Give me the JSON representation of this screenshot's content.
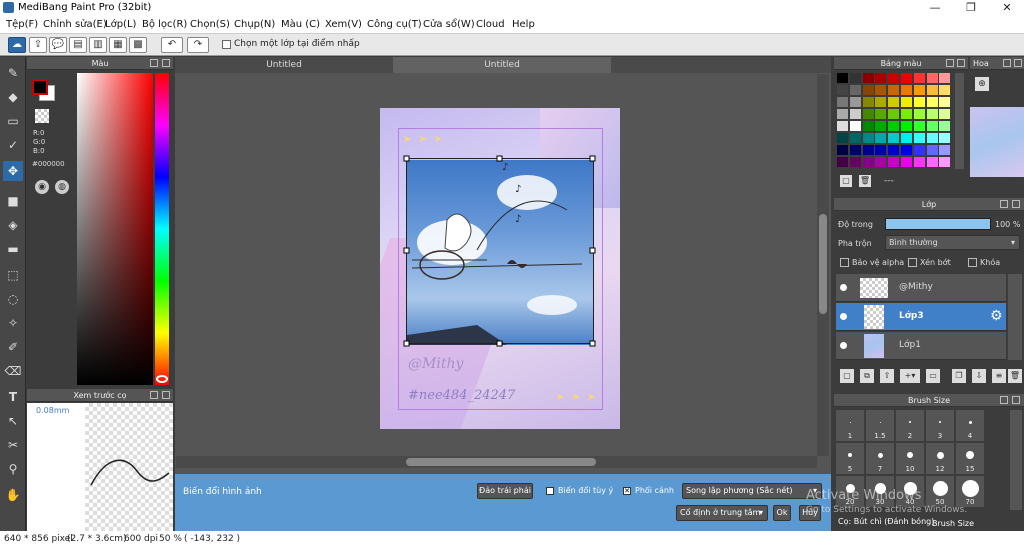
{
  "window": {
    "title": "MediBang Paint Pro (32bit)",
    "minimize": "—",
    "maximize": "❐",
    "close": "✕"
  },
  "menu": [
    "Tệp(F)",
    "Chỉnh sửa(E)",
    "Lớp(L)",
    "Bộ lọc(R)",
    "Chọn(S)",
    "Chụp(N)",
    "Màu (C)",
    "Xem(V)",
    "Công cụ(T)",
    "Cửa sổ(W)",
    "Cloud",
    "Help"
  ],
  "toolbar": {
    "checkbox_label": "Chọn một lớp tại điểm nhấp"
  },
  "color_panel": {
    "title": "Màu",
    "r": "R:0",
    "g": "G:0",
    "b": "B:0",
    "hex": "#000000"
  },
  "preview_panel": {
    "title": "Xem trước cọ",
    "size": "0.08mm"
  },
  "tabs": [
    "Untitled",
    "Untitled"
  ],
  "canvas": {
    "watermark1": "@Mithy",
    "watermark2": "#nee484_24247",
    "arrows": "➤ ➤ ➤"
  },
  "transform_bar": {
    "label": "Biến đổi hình ảnh",
    "flip_button": "Đảo trái phải",
    "free_transform": "Biến đổi tùy ý",
    "perspective": "Phối cảnh",
    "interp_select": "Song lập phương (Sắc nét)",
    "anchor_select": "Cố định ở trung tâm",
    "ok": "Ok",
    "cancel": "Hủy"
  },
  "status": {
    "size": "640 * 856 pixel",
    "cm": "(2.7 * 3.6cm)",
    "dpi": "600 dpi",
    "zoom": "50 %",
    "coords": "( -143, 232 )"
  },
  "swatches_panel": {
    "title": "Bảng màu",
    "dash": "---"
  },
  "nav_panel": {
    "title": "Hoa"
  },
  "layer_panel": {
    "title": "Lớp",
    "opacity_label": "Độ trong",
    "opacity_value": "100 %",
    "opacity": 1.0,
    "blend_label": "Pha trộn",
    "blend_value": "Bình thường",
    "alpha": "Bảo vệ alpha",
    "clip": "Xén bớt",
    "lock": "Khóa",
    "layers": [
      {
        "name": "@Mithy"
      },
      {
        "name": "Lớp3"
      },
      {
        "name": "Lớp1"
      }
    ]
  },
  "brush_panel": {
    "title": "Brush Size",
    "sizes": [
      "1",
      "1.5",
      "2",
      "3",
      "4",
      "5",
      "7",
      "10",
      "12",
      "15",
      "20",
      "30",
      "40",
      "50",
      "70"
    ],
    "footer_left": "Cọ: Bút chì (Đánh bóng)",
    "footer_right": "Brush Size"
  },
  "activation": {
    "line1": "Activate Windows",
    "line2": "Go to Settings to activate Windows."
  },
  "colors": {
    "accent": "#2e6aa8",
    "bottom_bar": "#5b99d2"
  }
}
